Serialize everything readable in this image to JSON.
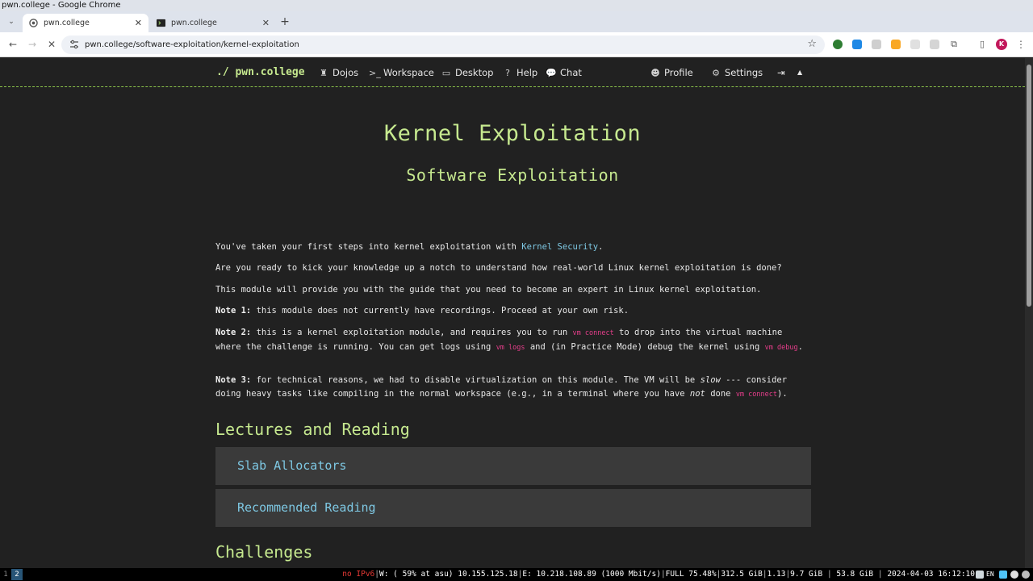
{
  "window": {
    "title": "pwn.college - Google Chrome"
  },
  "tabs": [
    {
      "label": "pwn.college",
      "active": true
    },
    {
      "label": "pwn.college",
      "active": false
    }
  ],
  "toolbar": {
    "url": "pwn.college/software-exploitation/kernel-exploitation",
    "profile_initial": "K"
  },
  "site_nav": {
    "brand": "./ pwn.college",
    "left_items": [
      {
        "label": "Dojos",
        "icon": "castle-icon"
      },
      {
        "label": "Workspace",
        "icon": "terminal-icon"
      },
      {
        "label": "Desktop",
        "icon": "monitor-icon"
      },
      {
        "label": "Help",
        "icon": "question-icon"
      },
      {
        "label": "Chat",
        "icon": "chat-icon"
      }
    ],
    "right_items": [
      {
        "label": "Profile",
        "icon": "user-icon"
      },
      {
        "label": "Settings",
        "icon": "gears-icon"
      }
    ]
  },
  "page": {
    "title": "Kernel Exploitation",
    "subtitle": "Software Exploitation",
    "p1_text": "You've taken your first steps into kernel exploitation with ",
    "p1_link": "Kernel Security",
    "p1_end": ".",
    "p2": "Are you ready to kick your knowledge up a notch to understand how real-world Linux kernel exploitation is done?",
    "p3": "This module will provide you with the guide that you need to become an expert in Linux kernel exploitation.",
    "note1_label": "Note 1:",
    "note1_text": " this module does not currently have recordings. Proceed at your own risk.",
    "note2_label": "Note 2:",
    "note2_a": " this is a kernel exploitation module, and requires you to run ",
    "note2_code1": "vm connect",
    "note2_b": " to drop into the virtual machine where the challenge is running. You can get logs using ",
    "note2_code2": "vm logs",
    "note2_c": " and (in Practice Mode) debug the kernel using ",
    "note2_code3": "vm debug",
    "note2_d": ".",
    "note3_label": "Note 3:",
    "note3_a": " for technical reasons, we had to disable virtualization on this module. The VM will be ",
    "note3_slow": "slow",
    "note3_b": " --- consider doing heavy tasks like compiling in the normal workspace (e.g., in a terminal where you have ",
    "note3_not": "not",
    "note3_c": " done ",
    "note3_code": "vm connect",
    "note3_d": ")."
  },
  "lectures": {
    "heading": "Lectures and Reading",
    "items": [
      "Slab Allocators",
      "Recommended Reading"
    ]
  },
  "challenges": {
    "heading": "Challenges"
  },
  "statusbar": {
    "workspaces": [
      "1",
      "2"
    ],
    "ipv6": "no IPv6",
    "wifi": "W: ( 59% at asu) 10.155.125.18",
    "eth": "E: 10.218.108.89 (1000 Mbit/s)",
    "disk": "FULL 75.48%",
    "disk_free": "312.5 GiB",
    "load": "1.13",
    "mem": "9.7 GiB",
    "mem_free": "53.8 GiB",
    "datetime": "2024-04-03 16:12:10",
    "lang": "EN"
  },
  "colors": {
    "accent_green": "#c6e98f",
    "link_blue": "#7ec8e3",
    "code_pink": "#e83e8c",
    "page_bg": "#212121"
  }
}
